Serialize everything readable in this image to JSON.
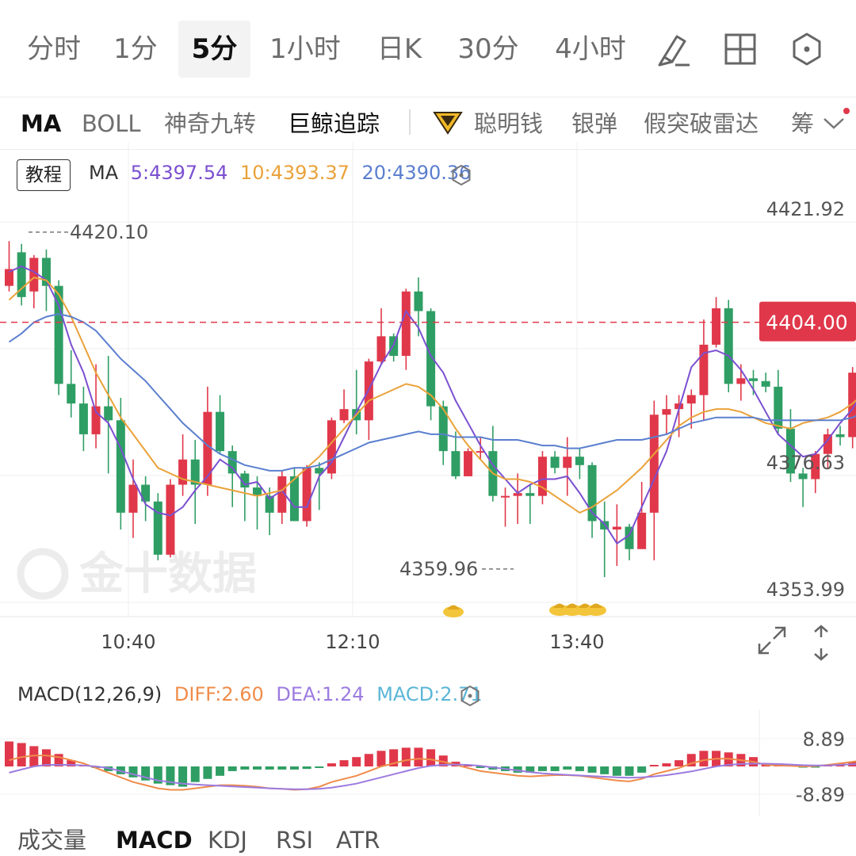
{
  "period_tabs": [
    "分时",
    "1分",
    "5分",
    "1小时",
    "日K",
    "30分",
    "4小时"
  ],
  "active_period": "5分",
  "indicator_tabs": [
    "MA",
    "BOLL",
    "神奇九转",
    "巨鲸追踪",
    "聪明钱",
    "银弹",
    "假突破雷达",
    "筹"
  ],
  "tutorial_label": "教程",
  "ma_legend": {
    "prefix": "MA",
    "ma5": "5:4397.54",
    "ma10": "10:4393.37",
    "ma20": "20:4390.36"
  },
  "macd_legend": {
    "prefix": "MACD(12,26,9)",
    "diff": "DIFF:2.60",
    "dea": "DEA:1.24",
    "macd": "MACD:2.71"
  },
  "bottom_tabs": [
    "成交量",
    "MACD",
    "KDJ",
    "RSI",
    "ATR"
  ],
  "active_bottom_tab": "MACD",
  "watermark": "金十数据",
  "colors": {
    "up": "#e0384a",
    "down": "#2f9e64",
    "ma5": "#7b4fd0",
    "ma10": "#eaa23a",
    "ma20": "#5b7fcf",
    "diff": "#ef8c4a",
    "dea": "#9c7be0",
    "macd_label": "#5bb6d6",
    "price_badge": "#e0384a"
  },
  "chart_data": [
    {
      "type": "candlestick",
      "x_ticks": [
        "10:40",
        "12:10",
        "13:40"
      ],
      "y_tick_labels": [
        "4421.92",
        "4376.63",
        "4353.99"
      ],
      "ylim": [
        4353.99,
        4421.92
      ],
      "high_marker": "4420.10",
      "low_marker": "4359.96",
      "current_price": "4404.00",
      "grid": true,
      "candles": [
        [
          4410.5,
          4413.5,
          4418.5,
          4409.5
        ],
        [
          4416.5,
          4408.5,
          4418.0,
          4407.0
        ],
        [
          4409.5,
          4415.5,
          4416.0,
          4406.5
        ],
        [
          4415.5,
          4410.5,
          4417.0,
          4406.0
        ],
        [
          4410.5,
          4393.0,
          4411.5,
          4391.0
        ],
        [
          4393.0,
          4389.5,
          4399.0,
          4387.0
        ],
        [
          4389.5,
          4384.0,
          4392.5,
          4381.0
        ],
        [
          4384.0,
          4389.0,
          4396.5,
          4381.5
        ],
        [
          4389.0,
          4386.5,
          4398.0,
          4377.0
        ],
        [
          4386.5,
          4370.0,
          4390.5,
          4367.0
        ],
        [
          4370.0,
          4375.0,
          4379.5,
          4365.5
        ],
        [
          4375.0,
          4372.0,
          4376.5,
          4368.5
        ],
        [
          4372.0,
          4362.5,
          4373.5,
          4361.5
        ],
        [
          4362.5,
          4375.0,
          4376.0,
          4362.0
        ],
        [
          4375.0,
          4379.5,
          4384.0,
          4373.0
        ],
        [
          4379.5,
          4375.0,
          4383.0,
          4368.0
        ],
        [
          4375.0,
          4388.0,
          4392.5,
          4373.0
        ],
        [
          4388.0,
          4381.0,
          4391.0,
          4380.5
        ],
        [
          4381.0,
          4377.0,
          4382.0,
          4371.0
        ],
        [
          4377.0,
          4374.5,
          4377.5,
          4368.5
        ],
        [
          4374.5,
          4373.0,
          4376.5,
          4367.0
        ],
        [
          4373.0,
          4370.0,
          4374.5,
          4366.0
        ],
        [
          4370.0,
          4376.5,
          4377.5,
          4368.0
        ],
        [
          4376.5,
          4368.5,
          4378.0,
          4368.5
        ],
        [
          4368.5,
          4378.0,
          4378.5,
          4367.5
        ],
        [
          4378.0,
          4377.0,
          4379.0,
          4370.5
        ],
        [
          4377.0,
          4386.5,
          4387.0,
          4376.0
        ],
        [
          4386.5,
          4388.5,
          4392.0,
          4386.0
        ],
        [
          4388.5,
          4386.5,
          4395.5,
          4384.0
        ],
        [
          4386.5,
          4397.0,
          4397.5,
          4383.0
        ],
        [
          4397.0,
          4401.5,
          4406.5,
          4396.5
        ],
        [
          4401.5,
          4398.0,
          4402.0,
          4397.0
        ],
        [
          4398.0,
          4409.5,
          4410.0,
          4395.5
        ],
        [
          4409.5,
          4406.0,
          4412.0,
          4401.5
        ],
        [
          4406.0,
          4389.0,
          4406.5,
          4386.5
        ],
        [
          4389.0,
          4381.0,
          4390.0,
          4378.5
        ],
        [
          4381.0,
          4376.5,
          4384.5,
          4376.0
        ],
        [
          4376.5,
          4381.0,
          4381.5,
          4376.5
        ],
        [
          4381.0,
          4381.0,
          4383.5,
          4379.5
        ],
        [
          4381.0,
          4373.0,
          4385.5,
          4372.0
        ],
        [
          4373.0,
          4373.0,
          4374.5,
          4367.5
        ],
        [
          4373.0,
          4373.5,
          4377.0,
          4368.0
        ],
        [
          4373.5,
          4373.0,
          4375.0,
          4368.0
        ],
        [
          4373.0,
          4380.0,
          4381.0,
          4371.5
        ],
        [
          4380.0,
          4378.0,
          4381.0,
          4377.0
        ],
        [
          4378.0,
          4380.0,
          4383.5,
          4373.0
        ],
        [
          4380.0,
          4378.5,
          4381.5,
          4376.0
        ],
        [
          4378.5,
          4368.5,
          4379.0,
          4365.5
        ],
        [
          4368.5,
          4367.0,
          4372.0,
          4358.5
        ],
        [
          4367.0,
          4367.5,
          4371.5,
          4360.5
        ],
        [
          4367.5,
          4363.5,
          4368.0,
          4361.5
        ],
        [
          4363.5,
          4370.0,
          4375.5,
          4368.0
        ],
        [
          4370.0,
          4387.5,
          4390.0,
          4361.5
        ],
        [
          4387.5,
          4388.5,
          4391.0,
          4384.0
        ],
        [
          4388.5,
          4389.5,
          4391.0,
          4383.5
        ],
        [
          4389.5,
          4391.0,
          4392.0,
          4385.0
        ],
        [
          4391.0,
          4400.0,
          4404.5,
          4386.5
        ],
        [
          4400.0,
          4406.5,
          4408.5,
          4399.5
        ],
        [
          4406.5,
          4393.0,
          4408.0,
          4391.5
        ],
        [
          4393.0,
          4394.0,
          4396.5,
          4390.0
        ],
        [
          4394.0,
          4393.5,
          4395.5,
          4391.0
        ],
        [
          4393.5,
          4392.5,
          4395.0,
          4391.5
        ],
        [
          4392.5,
          4385.0,
          4395.5,
          4384.0
        ],
        [
          4385.0,
          4377.0,
          4388.5,
          4375.5
        ],
        [
          4377.0,
          4376.0,
          4378.0,
          4371.0
        ],
        [
          4376.0,
          4380.5,
          4381.0,
          4373.5
        ],
        [
          4380.5,
          4384.0,
          4385.0,
          4378.0
        ],
        [
          4384.0,
          4383.5,
          4385.5,
          4382.0
        ],
        [
          4383.5,
          4395.0,
          4396.0,
          4381.5
        ],
        [
          4395.0,
          4397.0,
          4402.5,
          4394.5
        ],
        [
          4397.0,
          4395.5,
          4399.5,
          4392.0
        ],
        [
          4395.5,
          4402.0,
          4402.5,
          4395.0
        ],
        [
          4402.0,
          4399.0,
          4404.0,
          4396.5
        ]
      ],
      "series": [
        {
          "name": "MA5",
          "values": [
            4413.0,
            4414.0,
            4413.0,
            4411.5,
            4407.0,
            4400.0,
            4395.0,
            4388.0,
            4386.0,
            4381.5,
            4376.0,
            4371.5,
            4370.0,
            4369.5,
            4371.0,
            4374.0,
            4376.5,
            4379.5,
            4378.0,
            4375.0,
            4375.5,
            4372.5,
            4374.0,
            4371.0,
            4371.0,
            4376.5,
            4379.0,
            4383.5,
            4388.0,
            4392.0,
            4396.5,
            4400.0,
            4406.0,
            4403.0,
            4398.0,
            4395.0,
            4390.0,
            4386.0,
            4382.0,
            4378.5,
            4376.0,
            4373.5,
            4375.0,
            4376.0,
            4376.0,
            4376.5,
            4373.5,
            4370.0,
            4368.0,
            4364.5,
            4366.0,
            4371.0,
            4376.0,
            4381.0,
            4388.5,
            4396.0,
            4398.5,
            4399.0,
            4398.0,
            4395.5,
            4392.0,
            4388.0,
            4384.0,
            4382.0,
            4380.0,
            4380.5,
            4383.0,
            4386.0,
            4388.5,
            4392.5,
            4395.5,
            4399.0
          ]
        },
        {
          "name": "MA10",
          "values": [
            4408.0,
            4410.0,
            4412.0,
            4411.5,
            4409.0,
            4405.0,
            4400.0,
            4395.0,
            4391.0,
            4387.0,
            4384.0,
            4381.0,
            4378.0,
            4377.0,
            4376.0,
            4375.5,
            4375.0,
            4374.5,
            4374.0,
            4373.5,
            4373.0,
            4373.5,
            4374.0,
            4376.0,
            4378.0,
            4380.0,
            4382.5,
            4385.0,
            4387.5,
            4390.0,
            4391.0,
            4392.0,
            4393.0,
            4392.5,
            4391.0,
            4388.5,
            4385.0,
            4382.0,
            4379.5,
            4377.0,
            4376.0,
            4376.0,
            4375.5,
            4374.5,
            4373.0,
            4371.5,
            4370.0,
            4371.0,
            4372.5,
            4374.0,
            4376.0,
            4378.0,
            4380.5,
            4383.0,
            4385.5,
            4387.0,
            4388.0,
            4388.5,
            4388.5,
            4388.0,
            4387.0,
            4386.0,
            4385.5,
            4385.0,
            4386.0,
            4386.5,
            4387.0,
            4388.0,
            4389.5,
            4391.5,
            4393.5,
            4395.0
          ]
        },
        {
          "name": "MA20",
          "values": [
            4400.5,
            4402.0,
            4404.0,
            4405.0,
            4405.5,
            4405.0,
            4404.0,
            4402.5,
            4400.0,
            4397.5,
            4395.5,
            4393.5,
            4391.0,
            4388.5,
            4386.0,
            4384.0,
            4382.0,
            4380.5,
            4379.5,
            4378.5,
            4378.0,
            4377.5,
            4377.5,
            4378.0,
            4378.0,
            4378.5,
            4379.5,
            4380.5,
            4381.5,
            4382.5,
            4383.0,
            4383.5,
            4384.0,
            4384.5,
            4384.0,
            4384.0,
            4383.5,
            4383.5,
            4383.5,
            4383.0,
            4383.0,
            4383.0,
            4382.5,
            4382.0,
            4382.0,
            4381.5,
            4381.5,
            4382.0,
            4382.5,
            4383.0,
            4383.0,
            4383.0,
            4383.5,
            4384.0,
            4385.0,
            4386.0,
            4386.5,
            4387.0,
            4387.0,
            4387.0,
            4387.0,
            4386.5,
            4386.5,
            4386.5,
            4386.5,
            4386.5,
            4386.5,
            4386.5,
            4387.0,
            4388.0,
            4389.0,
            4390.5
          ]
        }
      ]
    },
    {
      "type": "macd",
      "indicator": "MACD(12,26,9)",
      "y_tick_labels": [
        "8.89",
        "-8.89"
      ],
      "ylim": [
        -8.89,
        8.89
      ],
      "macd_histogram": [
        8.0,
        7.5,
        6.5,
        5.5,
        4.0,
        2.0,
        0.5,
        -0.5,
        -1.5,
        -2.5,
        -3.5,
        -4.5,
        -5.5,
        -6.0,
        -6.5,
        -5.0,
        -4.0,
        -3.0,
        -1.5,
        -1.0,
        -1.0,
        -1.0,
        -1.0,
        -1.0,
        -0.8,
        -0.5,
        1.0,
        2.0,
        3.0,
        4.0,
        5.0,
        5.5,
        6.0,
        6.0,
        5.5,
        3.5,
        1.5,
        0.5,
        -0.5,
        -1.0,
        -1.5,
        -2.0,
        -2.0,
        -1.5,
        -1.5,
        -1.0,
        -1.5,
        -2.0,
        -2.5,
        -3.0,
        -3.0,
        -2.0,
        0.5,
        1.0,
        2.0,
        4.0,
        5.0,
        5.0,
        4.5,
        4.0,
        3.0,
        1.0,
        0.5,
        0.5,
        -0.2,
        -0.2,
        0.5,
        1.0,
        1.5,
        2.0,
        2.5,
        2.71
      ],
      "series": [
        {
          "name": "DIFF",
          "values": [
            2.0,
            3.0,
            3.5,
            3.5,
            3.0,
            2.0,
            1.0,
            -0.5,
            -2.0,
            -3.5,
            -5.0,
            -6.0,
            -7.0,
            -7.5,
            -7.5,
            -7.0,
            -6.5,
            -6.0,
            -6.0,
            -6.2,
            -6.5,
            -7.0,
            -7.2,
            -7.5,
            -7.3,
            -6.5,
            -5.0,
            -4.0,
            -3.0,
            -1.5,
            0.0,
            1.0,
            2.0,
            2.5,
            2.2,
            1.5,
            0.5,
            -0.5,
            -1.5,
            -2.0,
            -2.5,
            -3.0,
            -3.2,
            -3.0,
            -2.8,
            -2.8,
            -3.0,
            -3.5,
            -4.0,
            -4.5,
            -4.8,
            -4.0,
            -2.5,
            -1.5,
            -0.5,
            1.0,
            2.0,
            2.5,
            2.5,
            2.0,
            1.5,
            0.5,
            0.3,
            0.2,
            0.0,
            0.1,
            0.5,
            1.0,
            1.5,
            2.0,
            2.3,
            2.6
          ]
        },
        {
          "name": "DEA",
          "values": [
            -2.0,
            -1.0,
            0.0,
            0.5,
            0.5,
            0.5,
            0.3,
            0.0,
            -0.5,
            -1.5,
            -2.5,
            -3.5,
            -4.5,
            -5.0,
            -5.5,
            -5.8,
            -6.0,
            -6.2,
            -6.4,
            -6.6,
            -6.8,
            -7.0,
            -7.2,
            -7.3,
            -7.3,
            -7.2,
            -6.8,
            -6.2,
            -5.5,
            -4.5,
            -3.5,
            -2.5,
            -1.5,
            -0.5,
            0.2,
            0.5,
            0.6,
            0.5,
            0.2,
            -0.3,
            -0.8,
            -1.3,
            -1.8,
            -2.2,
            -2.5,
            -2.7,
            -2.9,
            -3.1,
            -3.3,
            -3.5,
            -3.6,
            -3.5,
            -3.2,
            -2.8,
            -2.2,
            -1.6,
            -0.8,
            0.0,
            0.5,
            0.8,
            0.9,
            0.9,
            0.8,
            0.6,
            0.4,
            0.3,
            0.3,
            0.5,
            0.7,
            0.9,
            1.1,
            1.24
          ]
        }
      ]
    }
  ]
}
